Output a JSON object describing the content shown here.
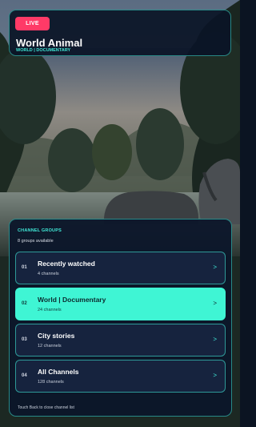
{
  "header": {
    "badge": "LIVE",
    "title": "World Animal",
    "category": "WORLD | DOCUMENTARY"
  },
  "groups": {
    "heading": "CHANNEL GROUPS",
    "count_text": "8 groups available",
    "selected_index": 1,
    "items": [
      {
        "number": "01",
        "name": "Recently watched",
        "subtitle": "4 channels",
        "chevron": ">"
      },
      {
        "number": "02",
        "name": "World | Documentary",
        "subtitle": "24 channels",
        "chevron": ">"
      },
      {
        "number": "03",
        "name": "City stories",
        "subtitle": "12 channels",
        "chevron": ">"
      },
      {
        "number": "04",
        "name": "All Channels",
        "subtitle": "128 channels",
        "chevron": ">"
      }
    ],
    "hint": "Touch Back to close channel list"
  },
  "colors": {
    "accent": "#3fe8d6",
    "selected_fill": "#3ff5d4",
    "live_badge": "#ff3a67",
    "panel_bg": "#0c162a"
  }
}
